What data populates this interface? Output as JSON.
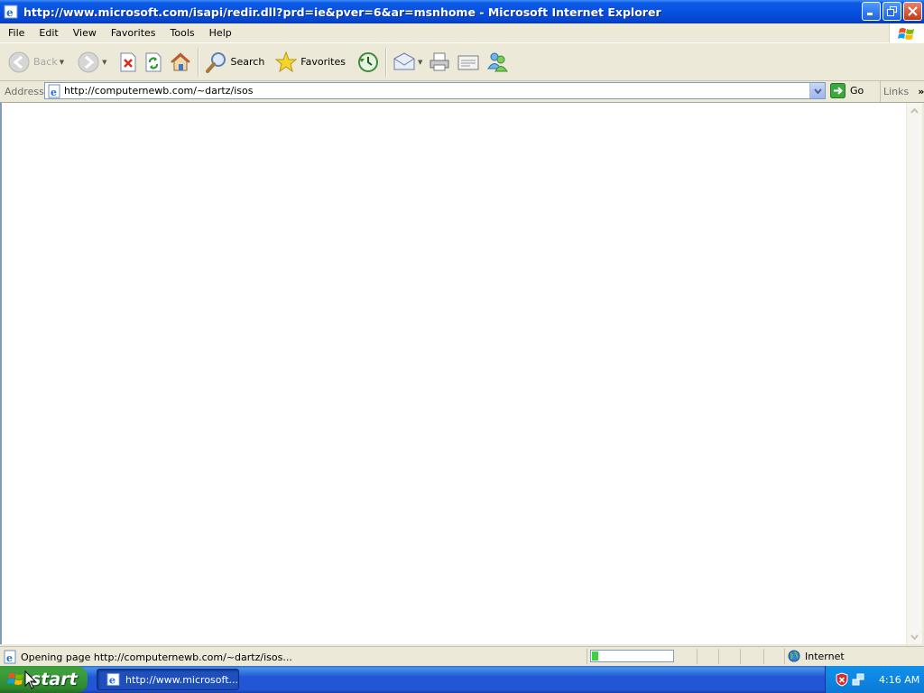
{
  "window": {
    "title": "http://www.microsoft.com/isapi/redir.dll?prd=ie&pver=6&ar=msnhome - Microsoft Internet Explorer"
  },
  "menu": {
    "items": [
      "File",
      "Edit",
      "View",
      "Favorites",
      "Tools",
      "Help"
    ]
  },
  "toolbar": {
    "back_label": "Back",
    "search_label": "Search",
    "favorites_label": "Favorites"
  },
  "address": {
    "label": "Address",
    "url": "http://computernewb.com/~dartz/isos",
    "go_label": "Go",
    "links_label": "Links"
  },
  "status": {
    "text": "Opening page http://computernewb.com/~dartz/isos...",
    "progress": 0.08,
    "zone": "Internet"
  },
  "taskbar": {
    "start_label": "start",
    "task_label": "http://www.microsoft...",
    "clock": "4:16 AM"
  },
  "colors": {
    "titlebar": "#0751e0",
    "taskbar": "#2157d7",
    "start": "#3c9c3c",
    "progress": "#3cd43c"
  }
}
